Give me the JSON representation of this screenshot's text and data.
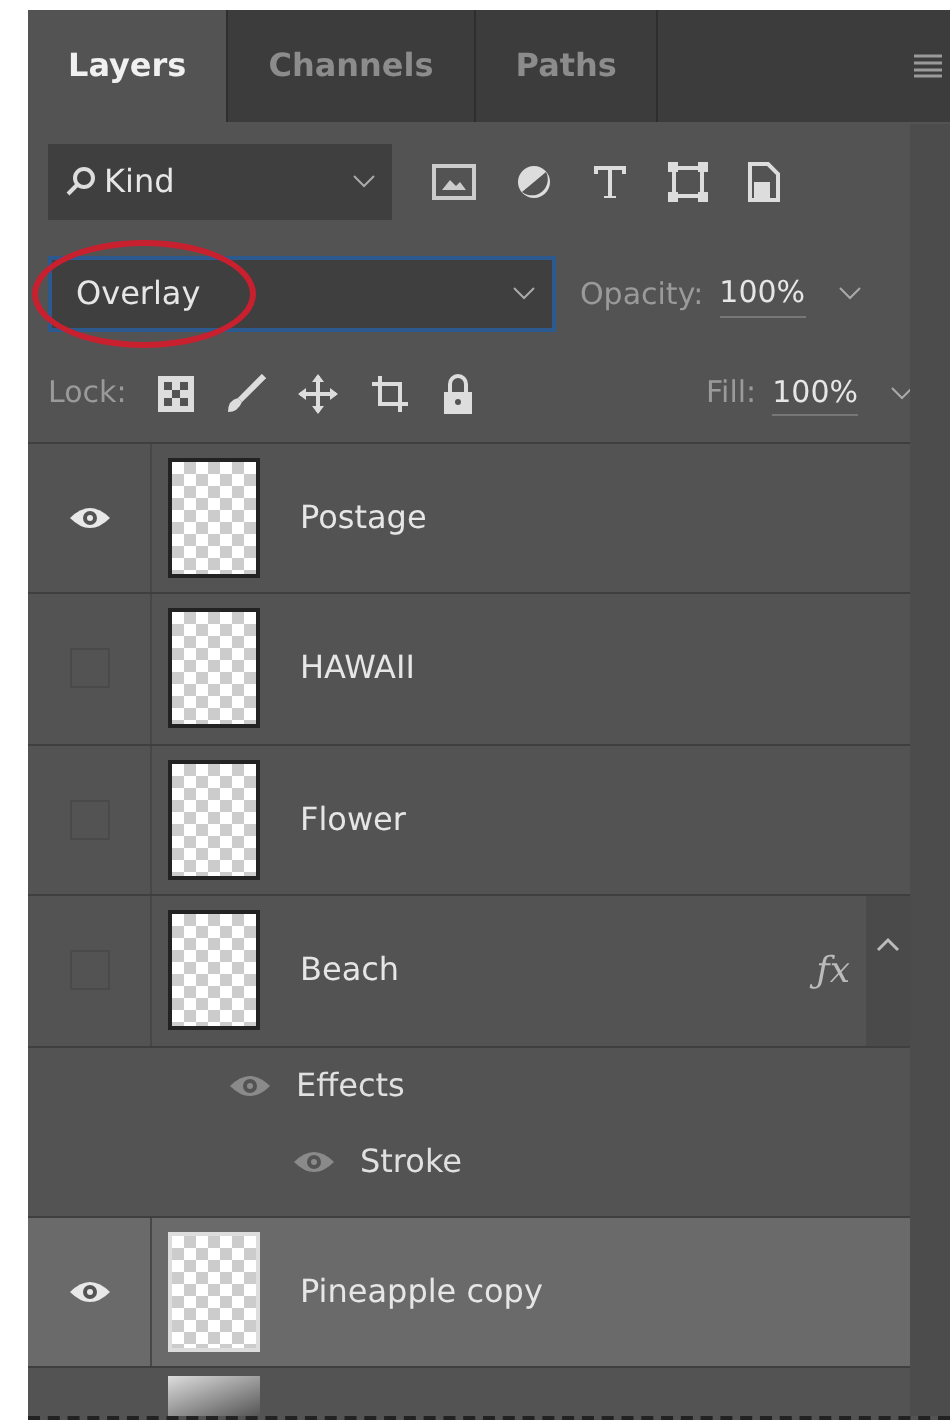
{
  "tabs": [
    {
      "label": "Layers",
      "selected": true
    },
    {
      "label": "Channels",
      "selected": false
    },
    {
      "label": "Paths",
      "selected": false
    }
  ],
  "filter": {
    "value": "Kind"
  },
  "blend": {
    "mode": "Overlay",
    "highlighted": true,
    "opacity_label": "Opacity:",
    "opacity": "100%"
  },
  "lock": {
    "label": "Lock:",
    "fill_label": "Fill:",
    "fill": "100%"
  },
  "layers": [
    {
      "kind": "layer",
      "name": "Postage",
      "visible": true,
      "selected": false
    },
    {
      "kind": "layer",
      "name": "HAWAII",
      "visible": false,
      "selected": false
    },
    {
      "kind": "layer",
      "name": "Flower",
      "visible": false,
      "selected": false
    },
    {
      "kind": "layer",
      "name": "Beach",
      "visible": false,
      "selected": false,
      "fx": "ƒx",
      "expanded": true,
      "children": [
        {
          "kind": "effect",
          "name": "Effects",
          "children": [
            {
              "kind": "effect",
              "name": "Stroke"
            }
          ]
        }
      ]
    },
    {
      "kind": "layer",
      "name": "Pineapple copy",
      "visible": true,
      "selected": true
    }
  ]
}
